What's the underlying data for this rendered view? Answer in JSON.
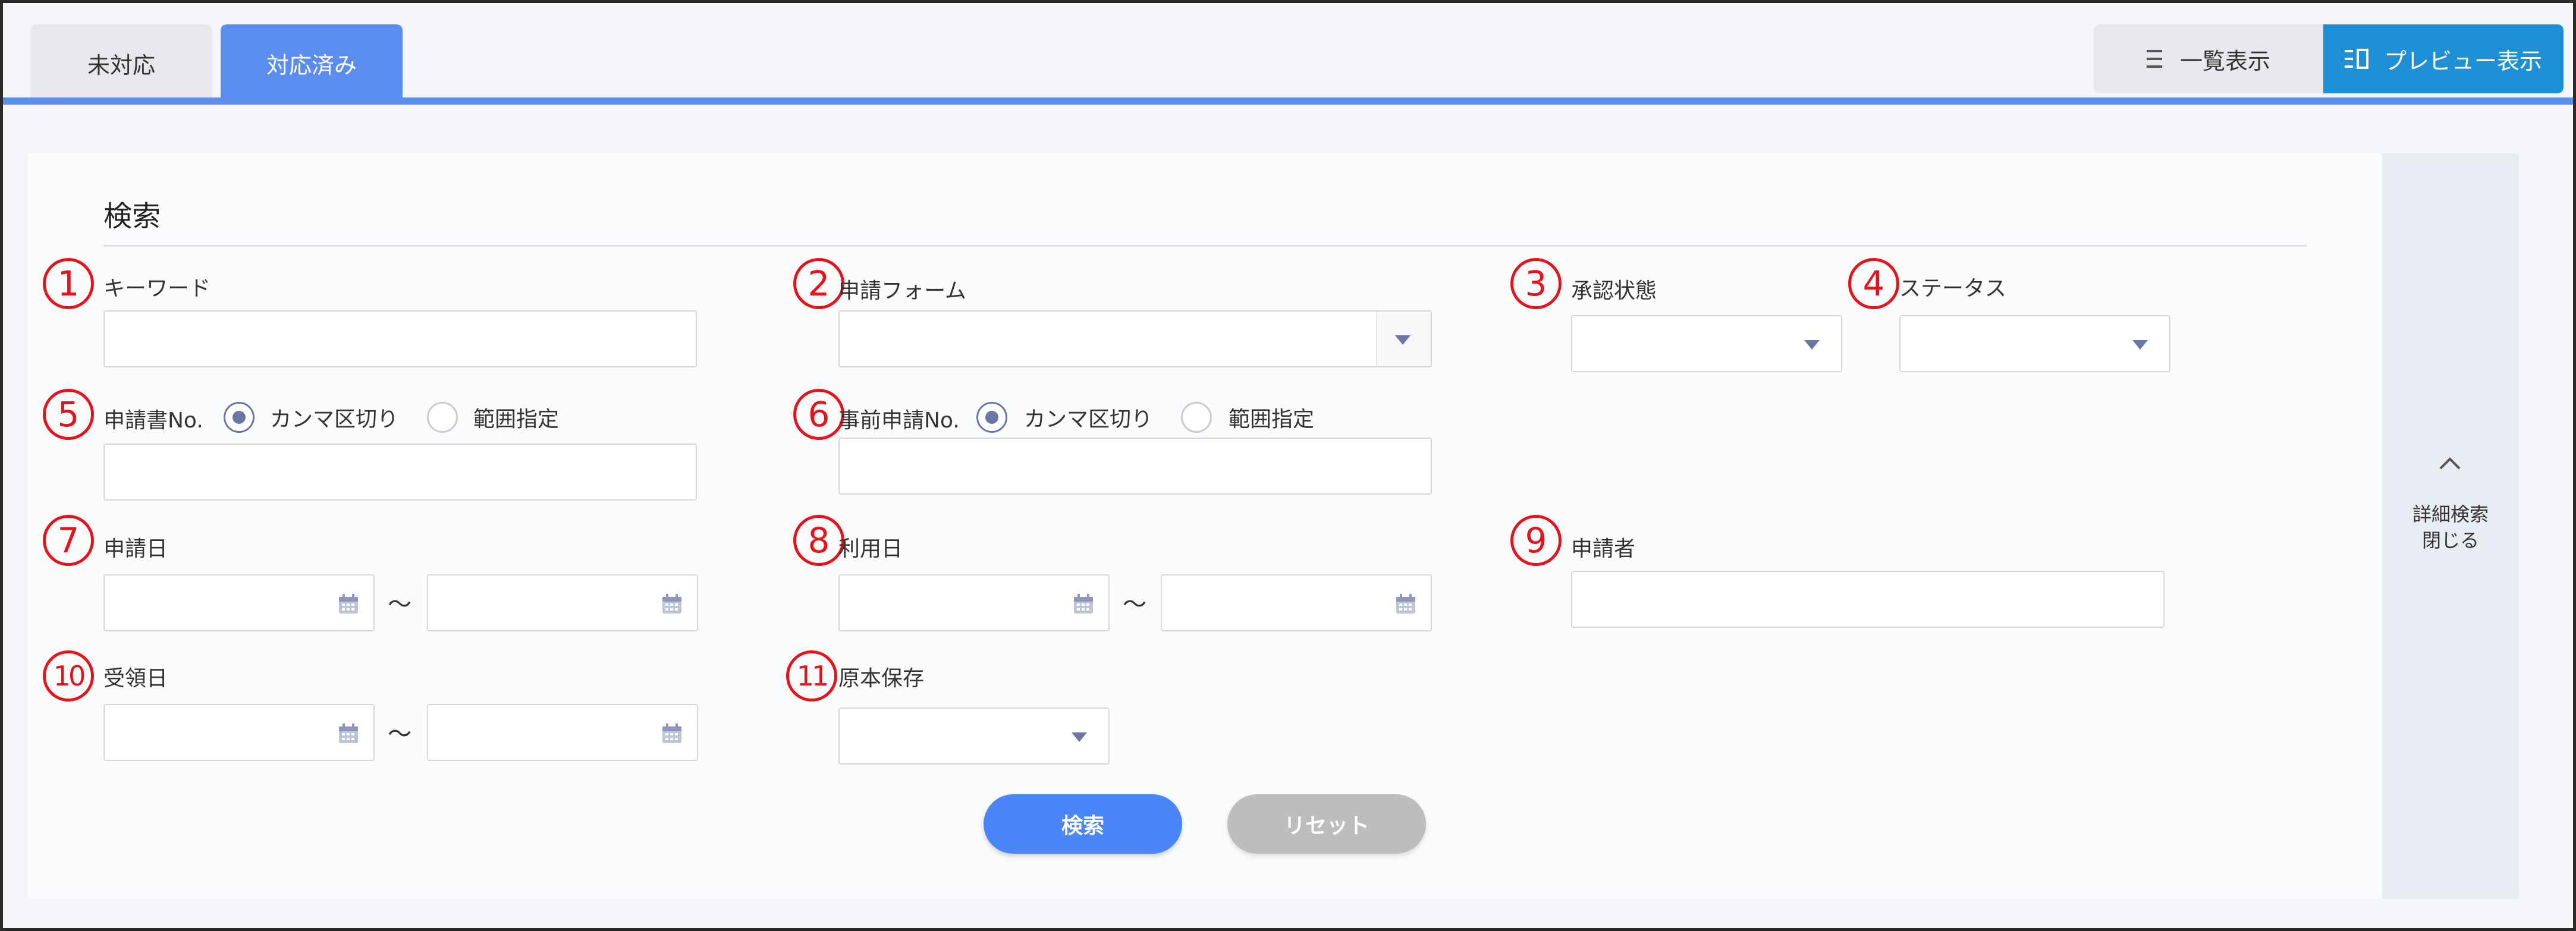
{
  "tabs": [
    {
      "label": "未対応",
      "active": false
    },
    {
      "label": "対応済み",
      "active": true
    }
  ],
  "view_toggle": {
    "list_label": "一覧表示",
    "preview_label": "プレビュー表示",
    "active": "preview"
  },
  "search": {
    "title": "検索",
    "fields": {
      "keyword": {
        "number": "1",
        "label": "キーワード",
        "value": ""
      },
      "form": {
        "number": "2",
        "label": "申請フォーム",
        "value": ""
      },
      "approval_state": {
        "number": "3",
        "label": "承認状態",
        "value": ""
      },
      "status": {
        "number": "4",
        "label": "ステータス",
        "value": ""
      },
      "application_no": {
        "number": "5",
        "label": "申請書No.",
        "options": [
          "カンマ区切り",
          "範囲指定"
        ],
        "selected": "カンマ区切り",
        "value": ""
      },
      "pre_application_no": {
        "number": "6",
        "label": "事前申請No.",
        "options": [
          "カンマ区切り",
          "範囲指定"
        ],
        "selected": "カンマ区切り",
        "value": ""
      },
      "application_date": {
        "number": "7",
        "label": "申請日",
        "from": "",
        "to": ""
      },
      "use_date": {
        "number": "8",
        "label": "利用日",
        "from": "",
        "to": ""
      },
      "applicant": {
        "number": "9",
        "label": "申請者",
        "value": ""
      },
      "receipt_date": {
        "number": "10",
        "label": "受領日",
        "from": "",
        "to": ""
      },
      "original_storage": {
        "number": "11",
        "label": "原本保存",
        "value": ""
      }
    },
    "range_separator": "～",
    "search_button": "検索",
    "reset_button": "リセット"
  },
  "side_panel": {
    "line1": "詳細検索",
    "line2": "閉じる"
  },
  "colors": {
    "accent": "#5b8def",
    "preview_button": "#1f8fd6",
    "search_button": "#4a86f7",
    "reset_button": "#bdbdbd",
    "annotation": "#e8131a",
    "radio": "#6b76a6"
  }
}
